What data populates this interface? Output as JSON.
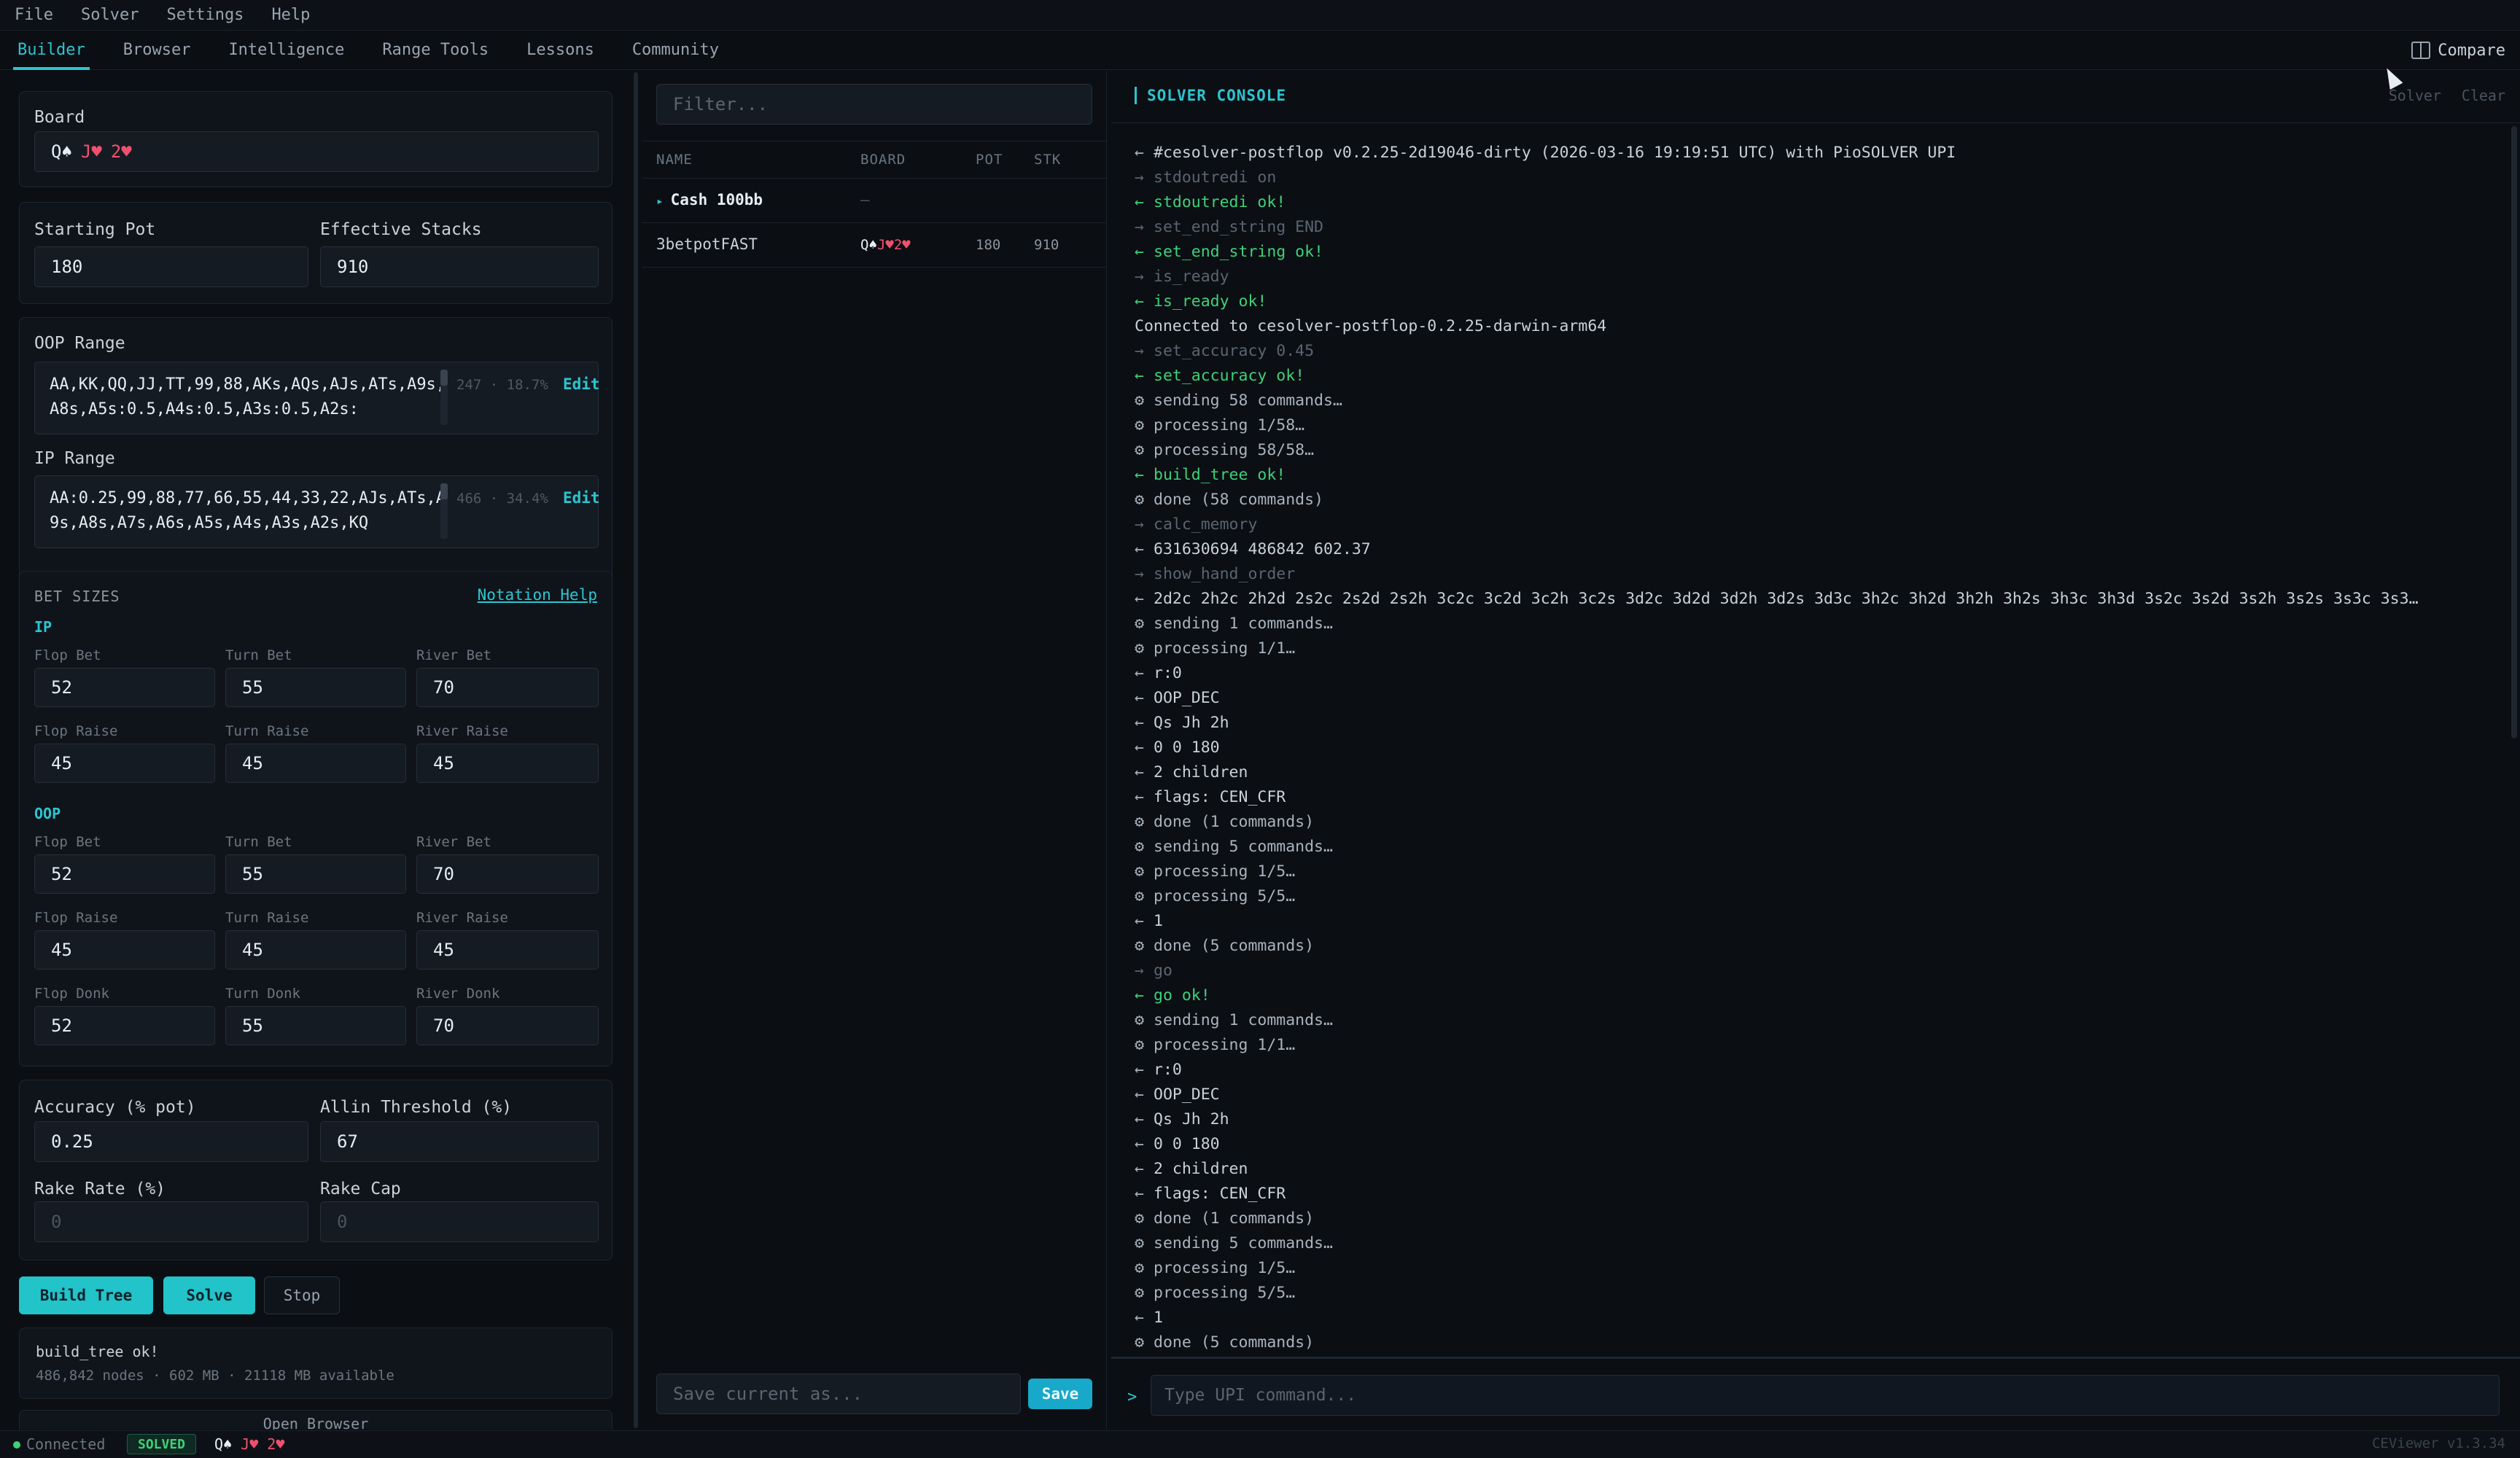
{
  "menu": [
    "File",
    "Solver",
    "Settings",
    "Help"
  ],
  "tabs": [
    "Builder",
    "Browser",
    "Intelligence",
    "Range Tools",
    "Lessons",
    "Community"
  ],
  "compare_label": "Compare",
  "board": {
    "label": "Board",
    "cards": [
      {
        "rank": "Q",
        "suit": "♠"
      },
      {
        "rank": "J",
        "suit": "♥"
      },
      {
        "rank": "2",
        "suit": "♥"
      }
    ]
  },
  "starting_pot": {
    "label": "Starting Pot",
    "value": "180"
  },
  "effective_stacks": {
    "label": "Effective Stacks",
    "value": "910"
  },
  "oop_range": {
    "label": "OOP Range",
    "text": "AA,KK,QQ,JJ,TT,99,88,AKs,AQs,AJs,ATs,A9s,A8s,A5s:0.5,A4s:0.5,A3s:0.5,A2s:",
    "meta": "247 · 18.7%",
    "edit": "Edit"
  },
  "ip_range": {
    "label": "IP Range",
    "text": "AA:0.25,99,88,77,66,55,44,33,22,AJs,ATs,A9s,A8s,A7s,A6s,A5s,A4s,A3s,A2s,KQ",
    "meta": "466 · 34.4%",
    "edit": "Edit"
  },
  "bet_sizes": {
    "title": "BET SIZES",
    "notation_help": "Notation Help",
    "ip": {
      "title": "IP",
      "flop_bet": {
        "label": "Flop Bet",
        "value": "52"
      },
      "turn_bet": {
        "label": "Turn Bet",
        "value": "55"
      },
      "river_bet": {
        "label": "River Bet",
        "value": "70"
      },
      "flop_raise": {
        "label": "Flop Raise",
        "value": "45"
      },
      "turn_raise": {
        "label": "Turn Raise",
        "value": "45"
      },
      "river_raise": {
        "label": "River Raise",
        "value": "45"
      }
    },
    "oop": {
      "title": "OOP",
      "flop_bet": {
        "label": "Flop Bet",
        "value": "52"
      },
      "turn_bet": {
        "label": "Turn Bet",
        "value": "55"
      },
      "river_bet": {
        "label": "River Bet",
        "value": "70"
      },
      "flop_raise": {
        "label": "Flop Raise",
        "value": "45"
      },
      "turn_raise": {
        "label": "Turn Raise",
        "value": "45"
      },
      "river_raise": {
        "label": "River Raise",
        "value": "45"
      },
      "flop_donk": {
        "label": "Flop Donk",
        "value": "52"
      },
      "turn_donk": {
        "label": "Turn Donk",
        "value": "55"
      },
      "river_donk": {
        "label": "River Donk",
        "value": "70"
      }
    }
  },
  "accuracy": {
    "label": "Accuracy (% pot)",
    "value": "0.25"
  },
  "allin_threshold": {
    "label": "Allin Threshold (%)",
    "value": "67"
  },
  "rake_rate": {
    "label": "Rake Rate (%)",
    "placeholder": "0"
  },
  "rake_cap": {
    "label": "Rake Cap",
    "placeholder": "0"
  },
  "actions": {
    "build_tree": "Build Tree",
    "solve": "Solve",
    "stop": "Stop"
  },
  "status_card": {
    "line1": "build_tree ok!",
    "line2": "486,842 nodes · 602 MB · 21118 MB available"
  },
  "open_browser": "Open Browser",
  "browser": {
    "filter_placeholder": "Filter...",
    "columns": [
      "NAME",
      "BOARD",
      "POT",
      "STK"
    ],
    "folder": {
      "name": "Cash 100bb",
      "board": "—"
    },
    "rows": [
      {
        "name": "3betpotFAST",
        "pot": "180",
        "stk": "910"
      }
    ],
    "save_placeholder": "Save current as...",
    "save_label": "Save"
  },
  "console": {
    "title": "SOLVER CONSOLE",
    "solver_label": "Solver",
    "clear_label": "Clear",
    "lines": [
      {
        "dir": "←",
        "kind": "in",
        "text": "#cesolver-postflop v0.2.25-2d19046-dirty (2026-03-16 19:19:51 UTC) with PioSOLVER UPI"
      },
      {
        "dir": "→",
        "kind": "out",
        "text": "stdoutredi on"
      },
      {
        "dir": "←",
        "kind": "ok",
        "text": "stdoutredi ok!"
      },
      {
        "dir": "→",
        "kind": "out",
        "text": "set_end_string END"
      },
      {
        "dir": "←",
        "kind": "ok",
        "text": "set_end_string ok!"
      },
      {
        "dir": "→",
        "kind": "out",
        "text": "is_ready"
      },
      {
        "dir": "←",
        "kind": "ok",
        "text": "is_ready ok!"
      },
      {
        "dir": "",
        "kind": "in",
        "text": "Connected to cesolver-postflop-0.2.25-darwin-arm64"
      },
      {
        "dir": "→",
        "kind": "out",
        "text": "set_accuracy 0.45"
      },
      {
        "dir": "←",
        "kind": "ok",
        "text": "set_accuracy ok!"
      },
      {
        "dir": "⚙",
        "kind": "info",
        "text": "sending 58 commands…"
      },
      {
        "dir": "⚙",
        "kind": "info",
        "text": "processing 1/58…"
      },
      {
        "dir": "⚙",
        "kind": "info",
        "text": "processing 58/58…"
      },
      {
        "dir": "←",
        "kind": "ok",
        "text": "build_tree ok!"
      },
      {
        "dir": "⚙",
        "kind": "info",
        "text": "done (58 commands)"
      },
      {
        "dir": "→",
        "kind": "out",
        "text": "calc_memory"
      },
      {
        "dir": "←",
        "kind": "in",
        "text": "631630694 486842 602.37"
      },
      {
        "dir": "→",
        "kind": "out",
        "text": "show_hand_order"
      },
      {
        "dir": "←",
        "kind": "in",
        "text": "2d2c 2h2c 2h2d 2s2c 2s2d 2s2h 3c2c 3c2d 3c2h 3c2s 3d2c 3d2d 3d2h 3d2s 3d3c 3h2c 3h2d 3h2h 3h2s 3h3c 3h3d 3s2c 3s2d 3s2h 3s2s 3s3c 3s3…"
      },
      {
        "dir": "⚙",
        "kind": "info",
        "text": "sending 1 commands…"
      },
      {
        "dir": "⚙",
        "kind": "info",
        "text": "processing 1/1…"
      },
      {
        "dir": "←",
        "kind": "in",
        "text": "r:0"
      },
      {
        "dir": "←",
        "kind": "in",
        "text": "OOP_DEC"
      },
      {
        "dir": "←",
        "kind": "in",
        "text": "Qs Jh 2h"
      },
      {
        "dir": "←",
        "kind": "in",
        "text": "0 0 180"
      },
      {
        "dir": "←",
        "kind": "in",
        "text": "2 children"
      },
      {
        "dir": "←",
        "kind": "in",
        "text": "flags: CEN_CFR"
      },
      {
        "dir": "⚙",
        "kind": "info",
        "text": "done (1 commands)"
      },
      {
        "dir": "⚙",
        "kind": "info",
        "text": "sending 5 commands…"
      },
      {
        "dir": "⚙",
        "kind": "info",
        "text": "processing 1/5…"
      },
      {
        "dir": "⚙",
        "kind": "info",
        "text": "processing 5/5…"
      },
      {
        "dir": "←",
        "kind": "in",
        "text": "1"
      },
      {
        "dir": "⚙",
        "kind": "info",
        "text": "done (5 commands)"
      },
      {
        "dir": "→",
        "kind": "out",
        "text": "go"
      },
      {
        "dir": "←",
        "kind": "ok",
        "text": "go ok!"
      },
      {
        "dir": "⚙",
        "kind": "info",
        "text": "sending 1 commands…"
      },
      {
        "dir": "⚙",
        "kind": "info",
        "text": "processing 1/1…"
      },
      {
        "dir": "←",
        "kind": "in",
        "text": "r:0"
      },
      {
        "dir": "←",
        "kind": "in",
        "text": "OOP_DEC"
      },
      {
        "dir": "←",
        "kind": "in",
        "text": "Qs Jh 2h"
      },
      {
        "dir": "←",
        "kind": "in",
        "text": "0 0 180"
      },
      {
        "dir": "←",
        "kind": "in",
        "text": "2 children"
      },
      {
        "dir": "←",
        "kind": "in",
        "text": "flags: CEN_CFR"
      },
      {
        "dir": "⚙",
        "kind": "info",
        "text": "done (1 commands)"
      },
      {
        "dir": "⚙",
        "kind": "info",
        "text": "sending 5 commands…"
      },
      {
        "dir": "⚙",
        "kind": "info",
        "text": "processing 1/5…"
      },
      {
        "dir": "⚙",
        "kind": "info",
        "text": "processing 5/5…"
      },
      {
        "dir": "←",
        "kind": "in",
        "text": "1"
      },
      {
        "dir": "⚙",
        "kind": "info",
        "text": "done (5 commands)"
      }
    ],
    "prompt": ">",
    "input_placeholder": "Type UPI command..."
  },
  "statusbar": {
    "connection": "Connected",
    "solved": "SOLVED",
    "version": "CEViewer v1.3.34"
  },
  "colors": {
    "accent": "#2bc6d0",
    "ok": "#3ed17a",
    "heart": "#f0506e",
    "background": "#0b0e13"
  }
}
